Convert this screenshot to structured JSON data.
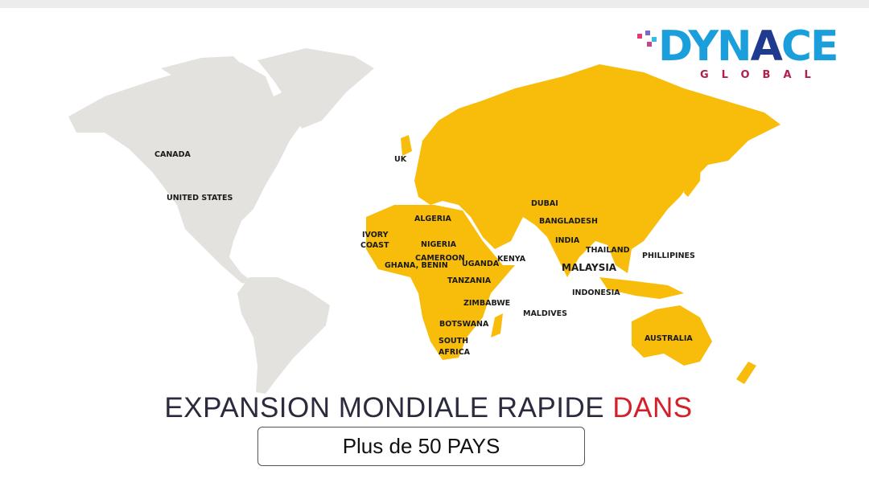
{
  "logo": {
    "word_part1": "DYN",
    "word_part2": "A",
    "word_part3": "CE",
    "sub": "GLOBAL"
  },
  "colors": {
    "highlight": "#f7bd0a",
    "other_land": "#e4e2df",
    "accent_red": "#d4202a",
    "logo_blue": "#1a9fdc"
  },
  "map": {
    "highlighted_regions": [
      "Europe",
      "Asia",
      "Africa",
      "Australia"
    ],
    "labels": {
      "canada": "CANADA",
      "united_states": "UNITED STATES",
      "uk": "UK",
      "algeria": "ALGERIA",
      "ivory_coast_1": "IVORY",
      "ivory_coast_2": "COAST",
      "nigeria": "NIGERIA",
      "cameroon": "CAMEROON",
      "ghana_benin": "GHANA, BENIN",
      "uganda": "UGANDA",
      "kenya": "KENYA",
      "tanzania": "TANZANIA",
      "zimbabwe": "ZIMBABWE",
      "botswana": "BOTSWANA",
      "south_africa_1": "SOUTH",
      "south_africa_2": "AFRICA",
      "maldives": "MALDIVES",
      "dubai": "DUBAI",
      "bangladesh": "BANGLADESH",
      "india": "INDIA",
      "thailand": "THAILAND",
      "malaysia": "MALAYSIA",
      "phillipines": "PHILLIPINES",
      "indonesia": "INDONESIA",
      "australia": "AUSTRALIA"
    }
  },
  "headline": {
    "main": "EXPANSION MONDIALE RAPIDE",
    "highlight": "DANS"
  },
  "badge": {
    "text": "Plus de 50 PAYS"
  }
}
